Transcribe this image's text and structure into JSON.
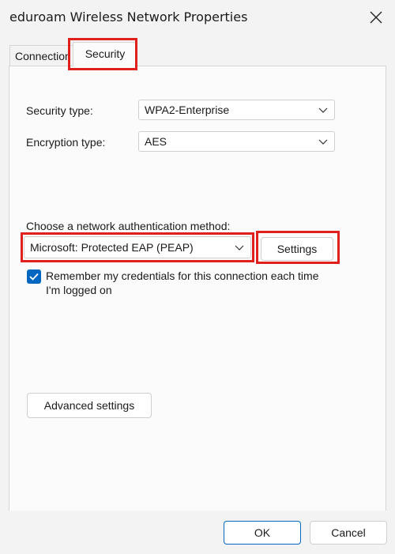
{
  "window": {
    "title": "eduroam Wireless Network Properties"
  },
  "tabs": [
    {
      "label": "Connection"
    },
    {
      "label": "Security"
    }
  ],
  "security_type": {
    "label": "Security type:",
    "value": "WPA2-Enterprise"
  },
  "encryption_type": {
    "label": "Encryption type:",
    "value": "AES"
  },
  "auth": {
    "label": "Choose a network authentication method:",
    "value": "Microsoft: Protected EAP (PEAP)",
    "settings_label": "Settings"
  },
  "remember": {
    "label": "Remember my credentials for this connection each time I'm logged on",
    "checked": true
  },
  "advanced_label": "Advanced settings",
  "footer": {
    "ok_label": "OK",
    "cancel_label": "Cancel"
  },
  "colors": {
    "accent": "#0067c0",
    "highlight_box": "#e0201c"
  },
  "icons": {
    "close": "close-icon",
    "chevron": "chevron-down-icon",
    "check": "checkmark-icon"
  }
}
